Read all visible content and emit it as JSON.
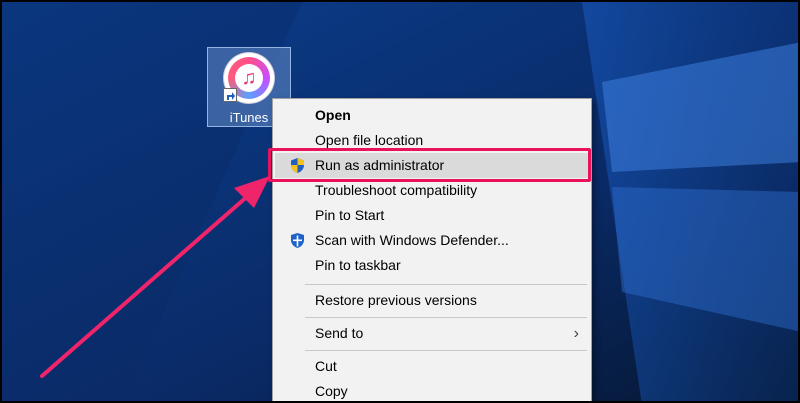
{
  "desktop": {
    "icon_label": "iTunes"
  },
  "menu": {
    "items": [
      {
        "label": "Open",
        "bold": true
      },
      {
        "label": "Open file location"
      },
      {
        "label": "Run as administrator",
        "icon": "uac-shield-icon"
      },
      {
        "label": "Troubleshoot compatibility"
      },
      {
        "label": "Pin to Start"
      },
      {
        "label": "Scan with Windows Defender...",
        "icon": "windows-defender-icon"
      },
      {
        "label": "Pin to taskbar"
      },
      {
        "label": "Restore previous versions"
      },
      {
        "label": "Send to",
        "submenu": true
      },
      {
        "label": "Cut"
      },
      {
        "label": "Copy"
      }
    ],
    "submenu_glyph": "›"
  },
  "annotation": {
    "highlight_color": "#e8135c",
    "arrow_color": "#f0246a"
  }
}
